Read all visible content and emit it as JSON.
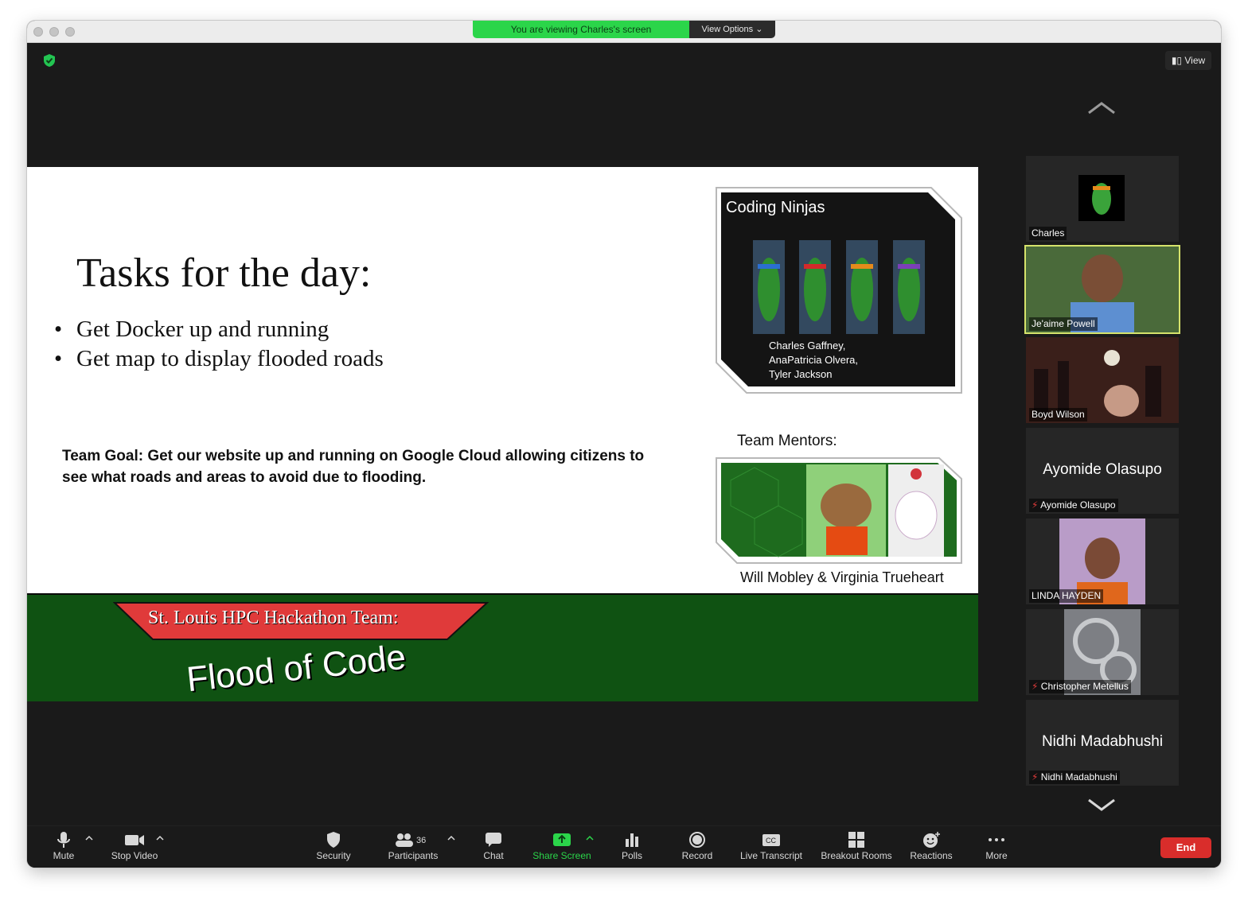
{
  "banner": {
    "viewing": "You are viewing Charles's screen",
    "options": "View Options"
  },
  "view_button": "View",
  "slide": {
    "title": "Tasks for the day:",
    "bullets": [
      "Get Docker up and running",
      "Get map to display flooded roads"
    ],
    "goal": "Team Goal: Get our website up and running on Google Cloud allowing citizens to see what roads and areas to avoid due to flooding.",
    "ninjas_title": "Coding Ninjas",
    "ninjas_names": [
      "Charles Gaffney,",
      "AnaPatricia Olvera,",
      "Tyler Jackson"
    ],
    "mentors_label": "Team Mentors:",
    "mentors_names": "Will Mobley & Virginia Trueheart",
    "footer_team": "St. Louis HPC Hackathon Team:",
    "footer_logo": "Flood of Code"
  },
  "participants": [
    {
      "name": "Charles",
      "big": ""
    },
    {
      "name": "Je'aime Powell",
      "big": ""
    },
    {
      "name": "Boyd Wilson",
      "big": ""
    },
    {
      "name": "Ayomide Olasupo",
      "big": "Ayomide Olasupo"
    },
    {
      "name": "LINDA HAYDEN",
      "big": ""
    },
    {
      "name": "Christopher Metellus",
      "big": ""
    },
    {
      "name": "Nidhi Madabhushi",
      "big": "Nidhi Madabhushi"
    }
  ],
  "toolbar": {
    "mute": "Mute",
    "stop_video": "Stop Video",
    "security": "Security",
    "participants": "Participants",
    "participants_count": "36",
    "chat": "Chat",
    "share": "Share Screen",
    "polls": "Polls",
    "record": "Record",
    "transcript": "Live Transcript",
    "breakout": "Breakout Rooms",
    "reactions": "Reactions",
    "more": "More",
    "end": "End"
  },
  "colors": {
    "banner_green": "#2bd54a",
    "end_red": "#d92d2b",
    "active_speaker": "#d6e36b",
    "slide_footer": "#0f5212"
  }
}
